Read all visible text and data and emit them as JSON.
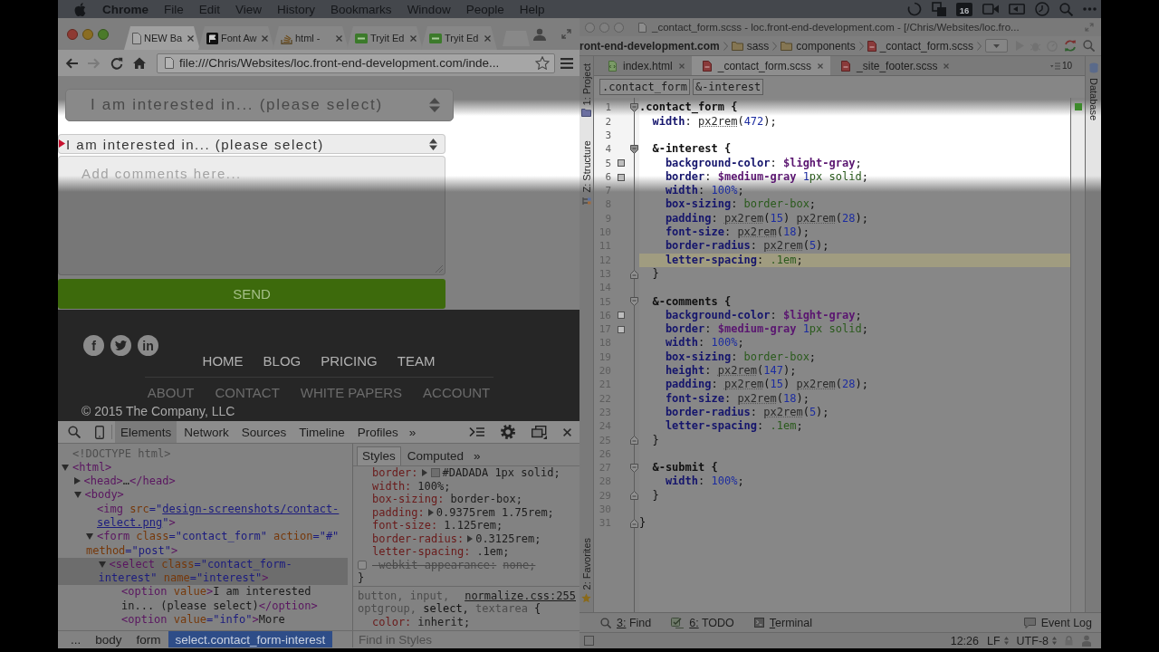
{
  "menubar": {
    "app": "Chrome",
    "menus": [
      "File",
      "Edit",
      "View",
      "History",
      "Bookmarks",
      "Window",
      "People",
      "Help"
    ],
    "calendar_day": "16"
  },
  "browser": {
    "tabs": [
      {
        "title": "NEW Ba",
        "kind": "page",
        "selected": true
      },
      {
        "title": "Font Aw",
        "kind": "flag",
        "selected": false
      },
      {
        "title": "html -",
        "kind": "stack",
        "selected": false
      },
      {
        "title": "Tryit Ed",
        "kind": "tile",
        "selected": false
      },
      {
        "title": "Tryit Ed",
        "kind": "tile",
        "selected": false
      }
    ],
    "toolbar": {
      "back_disabled": false,
      "forward_disabled": true,
      "url": "file:///Chris/Websites/loc.front-end-development.com/inde..."
    },
    "page": {
      "mockup_select": "I am interested in... (please select)",
      "select_value": "I am interested in... (please select)",
      "comments_placeholder": "Add comments here...",
      "send": "SEND",
      "social": [
        {
          "kind": "letter",
          "text": "f"
        },
        {
          "kind": "bird"
        },
        {
          "kind": "letter",
          "text": "in"
        }
      ],
      "primary_nav": [
        "HOME",
        "BLOG",
        "PRICING",
        "TEAM"
      ],
      "secondary_nav": [
        "ABOUT",
        "CONTACT",
        "WHITE PAPERS",
        "ACCOUNT"
      ],
      "copyright": "© 2015 The Company, LLC"
    }
  },
  "devtools": {
    "tabs": [
      {
        "label": "Elements",
        "selected": true
      },
      {
        "label": "Network",
        "selected": false
      },
      {
        "label": "Sources",
        "selected": false
      },
      {
        "label": "Timeline",
        "selected": false
      },
      {
        "label": "Profiles",
        "selected": false
      }
    ],
    "more": "»",
    "dom_tree": [
      {
        "tokens": [
          {
            "text": "<!DOCTYPE html>",
            "kind": "doctype"
          }
        ],
        "selected": false
      },
      {
        "tokens": [
          {
            "text": "<html>",
            "kind": "tag"
          }
        ],
        "expanded": true,
        "selected": false,
        "children": [
          {
            "tokens": [
              {
                "text": "<head>",
                "kind": "tag"
              },
              {
                "text": "…",
                "kind": "text"
              },
              {
                "text": "</head>",
                "kind": "tag"
              }
            ],
            "expanded": false,
            "selected": false
          },
          {
            "tokens": [
              {
                "text": "<body>",
                "kind": "tag"
              }
            ],
            "expanded": true,
            "selected": false,
            "children": [
              {
                "tokens": [
                  {
                    "text": "<img",
                    "kind": "tag"
                  },
                  {
                    "text": " src",
                    "kind": "attr"
                  },
                  {
                    "text": "=\"",
                    "kind": "value"
                  },
                  {
                    "text": "design-screenshots/contact-select.png",
                    "kind": "link"
                  },
                  {
                    "text": "\"",
                    "kind": "value"
                  },
                  {
                    "text": ">",
                    "kind": "tag"
                  }
                ],
                "selected": false
              },
              {
                "tokens": [
                  {
                    "text": "<form",
                    "kind": "tag"
                  },
                  {
                    "text": " class",
                    "kind": "attr"
                  },
                  {
                    "text": "=\"contact_form\"",
                    "kind": "value"
                  },
                  {
                    "text": " action",
                    "kind": "attr"
                  },
                  {
                    "text": "=\"#\"",
                    "kind": "value"
                  },
                  {
                    "text": " method",
                    "kind": "attr"
                  },
                  {
                    "text": "=\"post\"",
                    "kind": "value"
                  },
                  {
                    "text": ">",
                    "kind": "tag"
                  }
                ],
                "expanded": true,
                "selected": false,
                "children": [
                  {
                    "tokens": [
                      {
                        "text": "<select",
                        "kind": "tag"
                      },
                      {
                        "text": " class",
                        "kind": "attr"
                      },
                      {
                        "text": "=\"contact_form-interest\"",
                        "kind": "value"
                      },
                      {
                        "text": " name",
                        "kind": "attr"
                      },
                      {
                        "text": "=\"interest\"",
                        "kind": "value"
                      },
                      {
                        "text": ">",
                        "kind": "tag"
                      }
                    ],
                    "expanded": true,
                    "selected": true,
                    "children": [
                      {
                        "tokens": [
                          {
                            "text": "<option",
                            "kind": "tag"
                          },
                          {
                            "text": " value",
                            "kind": "attr"
                          },
                          {
                            "text": ">",
                            "kind": "tag"
                          },
                          {
                            "text": "I am interested in... (please select)",
                            "kind": "text"
                          },
                          {
                            "text": "</option>",
                            "kind": "tag"
                          }
                        ],
                        "selected": false
                      },
                      {
                        "tokens": [
                          {
                            "text": "<option",
                            "kind": "tag"
                          },
                          {
                            "text": " value",
                            "kind": "attr"
                          },
                          {
                            "text": "=\"info\"",
                            "kind": "value"
                          },
                          {
                            "text": ">",
                            "kind": "tag"
                          },
                          {
                            "text": "More",
                            "kind": "text"
                          }
                        ],
                        "selected": false
                      }
                    ]
                  }
                ]
              }
            ]
          }
        ]
      }
    ],
    "breadcrumbs": [
      {
        "label": "...",
        "selected": false
      },
      {
        "label": "body",
        "selected": false
      },
      {
        "label": "form",
        "selected": false
      },
      {
        "label": "select.contact_form-interest",
        "selected": true
      }
    ],
    "styles": {
      "tabs": [
        {
          "label": "Styles",
          "selected": true
        },
        {
          "label": "Computed",
          "selected": false
        }
      ],
      "more": "»",
      "rules": [
        {
          "properties": [
            {
              "name": "border:",
              "value": "#DADADA 1px solid;",
              "expandable": true,
              "color": "#6e6e6e",
              "enabled": true
            },
            {
              "name": "width:",
              "value": "100%;",
              "expandable": false,
              "enabled": true
            },
            {
              "name": "box-sizing:",
              "value": "border-box;",
              "expandable": false,
              "enabled": true
            },
            {
              "name": "padding:",
              "value": "0.9375rem 1.75rem;",
              "expandable": true,
              "enabled": true
            },
            {
              "name": "font-size:",
              "value": "1.125rem;",
              "expandable": false,
              "enabled": true
            },
            {
              "name": "border-radius:",
              "value": "0.3125rem;",
              "expandable": true,
              "enabled": true
            },
            {
              "name": "letter-spacing:",
              "value": ".1em;",
              "expandable": false,
              "enabled": true
            },
            {
              "name": "-webkit-appearance:",
              "value": "none;",
              "expandable": false,
              "enabled": false
            }
          ],
          "close": "}"
        },
        {
          "selectors": [
            {
              "text": "button,",
              "matched": false
            },
            {
              "text": " input,",
              "matched": false
            },
            {
              "text": " optgroup,",
              "matched": false
            },
            {
              "text": " select,",
              "matched": true
            },
            {
              "text": " textarea",
              "matched": false
            }
          ],
          "open": " {",
          "source": "normalize.css:255",
          "properties": [
            {
              "name": "color:",
              "value": "inherit;",
              "expandable": false,
              "enabled": true
            }
          ]
        }
      ],
      "filter_placeholder": "Find in Styles"
    }
  },
  "ide": {
    "title": "_contact_form.scss - loc.front-end-development.com - [/Chris/Websites/loc.fro...",
    "nav_path": [
      {
        "label": "ront-end-development.com",
        "kind": "project"
      },
      {
        "label": "sass",
        "kind": "folder"
      },
      {
        "label": "components",
        "kind": "folder"
      },
      {
        "label": "_contact_form.scss",
        "kind": "scss"
      }
    ],
    "tool_windows": {
      "left_top": [
        {
          "label": "1: Project",
          "kind": "project"
        },
        {
          "label": "Z: Structure",
          "kind": "structure"
        }
      ],
      "left_bottom": [
        {
          "label": "2: Favorites",
          "kind": "favorites"
        }
      ],
      "right": [
        {
          "label": "Database",
          "kind": "database"
        }
      ],
      "bottom_left": [
        {
          "label": "3: Find",
          "kind": "find"
        },
        {
          "label": "6: TODO",
          "kind": "todo"
        },
        {
          "label": "Terminal",
          "kind": "terminal"
        }
      ],
      "bottom_right": [
        {
          "label": "Event Log",
          "kind": "log"
        }
      ]
    },
    "tabs": [
      {
        "label": "index.html",
        "kind": "html",
        "selected": false
      },
      {
        "label": "_contact_form.scss",
        "kind": "scss",
        "selected": true
      },
      {
        "label": "_site_footer.scss",
        "kind": "scss",
        "selected": false
      }
    ],
    "hidden_tabs": "10",
    "breadcrumbs": [
      ".contact_form",
      "&-interest"
    ],
    "lines": [
      {
        "number": "1",
        "kind": "fold_start",
        "current": false,
        "tokens": [
          {
            "text": ".contact_form {",
            "kind": "selector"
          }
        ]
      },
      {
        "number": "2",
        "kind": "plain",
        "current": false,
        "tokens": [
          {
            "text": "  width",
            "kind": "property"
          },
          {
            "text": ": ",
            "kind": "plain"
          },
          {
            "text": "px2rem",
            "kind": "function"
          },
          {
            "text": "(",
            "kind": "plain"
          },
          {
            "text": "472",
            "kind": "number"
          },
          {
            "text": ");",
            "kind": "plain"
          }
        ]
      },
      {
        "number": "3",
        "kind": "plain",
        "current": false
      },
      {
        "number": "4",
        "kind": "fold_start",
        "current": false,
        "tokens": [
          {
            "text": "  &-interest {",
            "kind": "selector"
          }
        ]
      },
      {
        "number": "5",
        "kind": "swatch",
        "current": false,
        "tokens": [
          {
            "text": "    background-color",
            "kind": "property"
          },
          {
            "text": ": ",
            "kind": "plain"
          },
          {
            "text": "$light-gray",
            "kind": "variable"
          },
          {
            "text": ";",
            "kind": "plain"
          }
        ]
      },
      {
        "number": "6",
        "kind": "swatch",
        "current": false,
        "tokens": [
          {
            "text": "    border",
            "kind": "property"
          },
          {
            "text": ": ",
            "kind": "plain"
          },
          {
            "text": "$medium-gray",
            "kind": "variable"
          },
          {
            "text": " 1",
            "kind": "number"
          },
          {
            "text": "px solid",
            "kind": "keyword"
          },
          {
            "text": ";",
            "kind": "plain"
          }
        ]
      },
      {
        "number": "7",
        "kind": "plain",
        "current": false,
        "tokens": [
          {
            "text": "    width",
            "kind": "property"
          },
          {
            "text": ": ",
            "kind": "plain"
          },
          {
            "text": "100%",
            "kind": "number"
          },
          {
            "text": ";",
            "kind": "plain"
          }
        ]
      },
      {
        "number": "8",
        "kind": "plain",
        "current": false,
        "tokens": [
          {
            "text": "    box-sizing",
            "kind": "property"
          },
          {
            "text": ": ",
            "kind": "plain"
          },
          {
            "text": "border-box",
            "kind": "keyword"
          },
          {
            "text": ";",
            "kind": "plain"
          }
        ]
      },
      {
        "number": "9",
        "kind": "plain",
        "current": false,
        "tokens": [
          {
            "text": "    padding",
            "kind": "property"
          },
          {
            "text": ": ",
            "kind": "plain"
          },
          {
            "text": "px2rem",
            "kind": "function"
          },
          {
            "text": "(",
            "kind": "plain"
          },
          {
            "text": "15",
            "kind": "number"
          },
          {
            "text": ") ",
            "kind": "plain"
          },
          {
            "text": "px2rem",
            "kind": "function"
          },
          {
            "text": "(",
            "kind": "plain"
          },
          {
            "text": "28",
            "kind": "number"
          },
          {
            "text": ");",
            "kind": "plain"
          }
        ]
      },
      {
        "number": "10",
        "kind": "plain",
        "current": false,
        "tokens": [
          {
            "text": "    font-size",
            "kind": "property"
          },
          {
            "text": ": ",
            "kind": "plain"
          },
          {
            "text": "px2rem",
            "kind": "function"
          },
          {
            "text": "(",
            "kind": "plain"
          },
          {
            "text": "18",
            "kind": "number"
          },
          {
            "text": ");",
            "kind": "plain"
          }
        ]
      },
      {
        "number": "11",
        "kind": "plain",
        "current": false,
        "tokens": [
          {
            "text": "    border-radius",
            "kind": "property"
          },
          {
            "text": ": ",
            "kind": "plain"
          },
          {
            "text": "px2rem",
            "kind": "function"
          },
          {
            "text": "(",
            "kind": "plain"
          },
          {
            "text": "5",
            "kind": "number"
          },
          {
            "text": ");",
            "kind": "plain"
          }
        ]
      },
      {
        "number": "12",
        "kind": "plain",
        "current": true,
        "tokens": [
          {
            "text": "    letter-spacing",
            "kind": "property"
          },
          {
            "text": ": ",
            "kind": "plain"
          },
          {
            "text": ".1em",
            "kind": "keyword"
          },
          {
            "text": ";",
            "kind": "plain"
          }
        ]
      },
      {
        "number": "13",
        "kind": "fold_end",
        "current": false,
        "tokens": [
          {
            "text": "  }",
            "kind": "plain"
          }
        ]
      },
      {
        "number": "14",
        "kind": "plain",
        "current": false
      },
      {
        "number": "15",
        "kind": "fold_start",
        "current": false,
        "tokens": [
          {
            "text": "  &-comments {",
            "kind": "selector"
          }
        ]
      },
      {
        "number": "16",
        "kind": "swatch",
        "current": false,
        "tokens": [
          {
            "text": "    background-color",
            "kind": "property"
          },
          {
            "text": ": ",
            "kind": "plain"
          },
          {
            "text": "$light-gray",
            "kind": "variable"
          },
          {
            "text": ";",
            "kind": "plain"
          }
        ]
      },
      {
        "number": "17",
        "kind": "swatch",
        "current": false,
        "tokens": [
          {
            "text": "    border",
            "kind": "property"
          },
          {
            "text": ": ",
            "kind": "plain"
          },
          {
            "text": "$medium-gray",
            "kind": "variable"
          },
          {
            "text": " 1",
            "kind": "number"
          },
          {
            "text": "px solid",
            "kind": "keyword"
          },
          {
            "text": ";",
            "kind": "plain"
          }
        ]
      },
      {
        "number": "18",
        "kind": "plain",
        "current": false,
        "tokens": [
          {
            "text": "    width",
            "kind": "property"
          },
          {
            "text": ": ",
            "kind": "plain"
          },
          {
            "text": "100%",
            "kind": "number"
          },
          {
            "text": ";",
            "kind": "plain"
          }
        ]
      },
      {
        "number": "19",
        "kind": "plain",
        "current": false,
        "tokens": [
          {
            "text": "    box-sizing",
            "kind": "property"
          },
          {
            "text": ": ",
            "kind": "plain"
          },
          {
            "text": "border-box",
            "kind": "keyword"
          },
          {
            "text": ";",
            "kind": "plain"
          }
        ]
      },
      {
        "number": "20",
        "kind": "plain",
        "current": false,
        "tokens": [
          {
            "text": "    height",
            "kind": "property"
          },
          {
            "text": ": ",
            "kind": "plain"
          },
          {
            "text": "px2rem",
            "kind": "function"
          },
          {
            "text": "(",
            "kind": "plain"
          },
          {
            "text": "147",
            "kind": "number"
          },
          {
            "text": ");",
            "kind": "plain"
          }
        ]
      },
      {
        "number": "21",
        "kind": "plain",
        "current": false,
        "tokens": [
          {
            "text": "    padding",
            "kind": "property"
          },
          {
            "text": ": ",
            "kind": "plain"
          },
          {
            "text": "px2rem",
            "kind": "function"
          },
          {
            "text": "(",
            "kind": "plain"
          },
          {
            "text": "15",
            "kind": "number"
          },
          {
            "text": ") ",
            "kind": "plain"
          },
          {
            "text": "px2rem",
            "kind": "function"
          },
          {
            "text": "(",
            "kind": "plain"
          },
          {
            "text": "28",
            "kind": "number"
          },
          {
            "text": ");",
            "kind": "plain"
          }
        ]
      },
      {
        "number": "22",
        "kind": "plain",
        "current": false,
        "tokens": [
          {
            "text": "    font-size",
            "kind": "property"
          },
          {
            "text": ": ",
            "kind": "plain"
          },
          {
            "text": "px2rem",
            "kind": "function"
          },
          {
            "text": "(",
            "kind": "plain"
          },
          {
            "text": "18",
            "kind": "number"
          },
          {
            "text": ");",
            "kind": "plain"
          }
        ]
      },
      {
        "number": "23",
        "kind": "plain",
        "current": false,
        "tokens": [
          {
            "text": "    border-radius",
            "kind": "property"
          },
          {
            "text": ": ",
            "kind": "plain"
          },
          {
            "text": "px2rem",
            "kind": "function"
          },
          {
            "text": "(",
            "kind": "plain"
          },
          {
            "text": "5",
            "kind": "number"
          },
          {
            "text": ");",
            "kind": "plain"
          }
        ]
      },
      {
        "number": "24",
        "kind": "plain",
        "current": false,
        "tokens": [
          {
            "text": "    letter-spacing",
            "kind": "property"
          },
          {
            "text": ": ",
            "kind": "plain"
          },
          {
            "text": ".1em",
            "kind": "keyword"
          },
          {
            "text": ";",
            "kind": "plain"
          }
        ]
      },
      {
        "number": "25",
        "kind": "fold_end",
        "current": false,
        "tokens": [
          {
            "text": "  }",
            "kind": "plain"
          }
        ]
      },
      {
        "number": "26",
        "kind": "plain",
        "current": false
      },
      {
        "number": "27",
        "kind": "fold_start",
        "current": false,
        "tokens": [
          {
            "text": "  &-submit {",
            "kind": "selector"
          }
        ]
      },
      {
        "number": "28",
        "kind": "plain",
        "current": false,
        "tokens": [
          {
            "text": "    width",
            "kind": "property"
          },
          {
            "text": ": ",
            "kind": "plain"
          },
          {
            "text": "100%",
            "kind": "number"
          },
          {
            "text": ";",
            "kind": "plain"
          }
        ]
      },
      {
        "number": "29",
        "kind": "fold_end",
        "current": false,
        "tokens": [
          {
            "text": "  }",
            "kind": "plain"
          }
        ]
      },
      {
        "number": "30",
        "kind": "plain",
        "current": false
      },
      {
        "number": "31",
        "kind": "fold_end",
        "current": false,
        "tokens": [
          {
            "text": "}",
            "kind": "plain"
          }
        ]
      }
    ],
    "status": {
      "position": "12:26",
      "line_ending": "LF",
      "encoding": "UTF-8"
    }
  }
}
